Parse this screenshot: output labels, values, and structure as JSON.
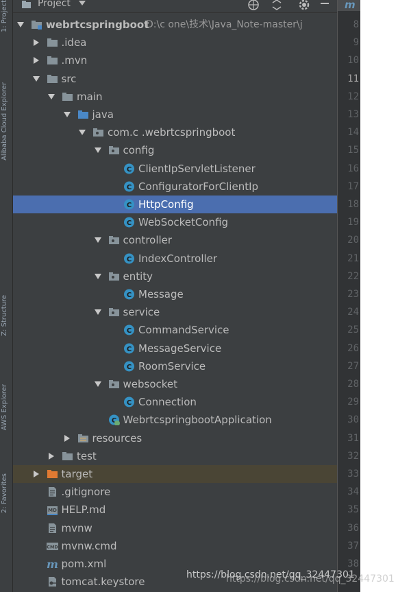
{
  "panel": {
    "title": "Project",
    "accent_selected": "#4b6eaf",
    "icons": [
      "globe-icon",
      "collapse-icon",
      "settings-icon",
      "hide-icon"
    ]
  },
  "sidebar_labels": [
    "1: Project",
    "Alibaba Cloud Explorer",
    "Z: Structure",
    "AWS Explorer",
    "2: Favorites"
  ],
  "tree": [
    {
      "label": "webrtcspringboot",
      "path": "D:\\c   one\\技术\\Java_Note-master\\j",
      "icon": "module-folder-icon",
      "arrow": "down",
      "level": 0,
      "bold": true
    },
    {
      "label": ".idea",
      "icon": "folder-icon",
      "arrow": "right",
      "level": 1
    },
    {
      "label": ".mvn",
      "icon": "folder-icon",
      "arrow": "right",
      "level": 1
    },
    {
      "label": "src",
      "icon": "folder-icon",
      "arrow": "down",
      "level": 1
    },
    {
      "label": "main",
      "icon": "folder-icon",
      "arrow": "down",
      "level": 2
    },
    {
      "label": "java",
      "icon": "source-folder-icon",
      "arrow": "down",
      "level": 3
    },
    {
      "label": "com.c   .webrtcspringboot",
      "icon": "package-icon",
      "arrow": "down",
      "level": 4
    },
    {
      "label": "config",
      "icon": "package-icon",
      "arrow": "down",
      "level": 5
    },
    {
      "label": "ClientIpServletListener",
      "icon": "class-icon",
      "arrow": "none",
      "level": 6
    },
    {
      "label": "ConfiguratorForClientIp",
      "icon": "class-icon",
      "arrow": "none",
      "level": 6
    },
    {
      "label": "HttpConfig",
      "icon": "class-icon",
      "arrow": "none",
      "level": 6,
      "selected": true
    },
    {
      "label": "WebSocketConfig",
      "icon": "class-icon",
      "arrow": "none",
      "level": 6
    },
    {
      "label": "controller",
      "icon": "package-icon",
      "arrow": "down",
      "level": 5
    },
    {
      "label": "IndexController",
      "icon": "class-icon",
      "arrow": "none",
      "level": 6
    },
    {
      "label": "entity",
      "icon": "package-icon",
      "arrow": "down",
      "level": 5
    },
    {
      "label": "Message",
      "icon": "class-icon",
      "arrow": "none",
      "level": 6
    },
    {
      "label": "service",
      "icon": "package-icon",
      "arrow": "down",
      "level": 5
    },
    {
      "label": "CommandService",
      "icon": "class-icon",
      "arrow": "none",
      "level": 6
    },
    {
      "label": "MessageService",
      "icon": "class-icon",
      "arrow": "none",
      "level": 6
    },
    {
      "label": "RoomService",
      "icon": "class-icon",
      "arrow": "none",
      "level": 6
    },
    {
      "label": "websocket",
      "icon": "package-icon",
      "arrow": "down",
      "level": 5
    },
    {
      "label": "Connection",
      "icon": "class-icon",
      "arrow": "none",
      "level": 6
    },
    {
      "label": "WebrtcspringbootApplication",
      "icon": "spring-boot-class-icon",
      "arrow": "none",
      "level": 5
    },
    {
      "label": "resources",
      "icon": "resources-folder-icon",
      "arrow": "right",
      "level": 3
    },
    {
      "label": "test",
      "icon": "folder-icon",
      "arrow": "right",
      "level": 2
    },
    {
      "label": "target",
      "icon": "excluded-folder-icon",
      "arrow": "right",
      "level": 1,
      "highlight": true
    },
    {
      "label": ".gitignore",
      "icon": "text-file-icon",
      "arrow": "none",
      "level": 1
    },
    {
      "label": "HELP.md",
      "icon": "markdown-file-icon",
      "arrow": "none",
      "level": 1
    },
    {
      "label": "mvnw",
      "icon": "text-file-icon",
      "arrow": "none",
      "level": 1
    },
    {
      "label": "mvnw.cmd",
      "icon": "cmd-file-icon",
      "arrow": "none",
      "level": 1
    },
    {
      "label": "pom.xml",
      "icon": "maven-file-icon",
      "arrow": "none",
      "level": 1
    },
    {
      "label": "tomcat.keystore",
      "icon": "keystore-file-icon",
      "arrow": "none",
      "level": 1
    }
  ],
  "gutter": {
    "lines": [
      "8",
      "9",
      "10",
      "11",
      "12",
      "13",
      "14",
      "15",
      "16",
      "17",
      "18",
      "19",
      "20",
      "21",
      "22",
      "23",
      "24",
      "25",
      "26",
      "27",
      "28",
      "29",
      "30",
      "31",
      "32",
      "33",
      "34",
      "35",
      "36",
      "37",
      "38"
    ],
    "current_line": "11",
    "tab_label": "m"
  },
  "watermark": "https://blog.csdn.net/qq_32447301",
  "watermark_shadow": "https://blog.csdn.net/qq_32447301"
}
